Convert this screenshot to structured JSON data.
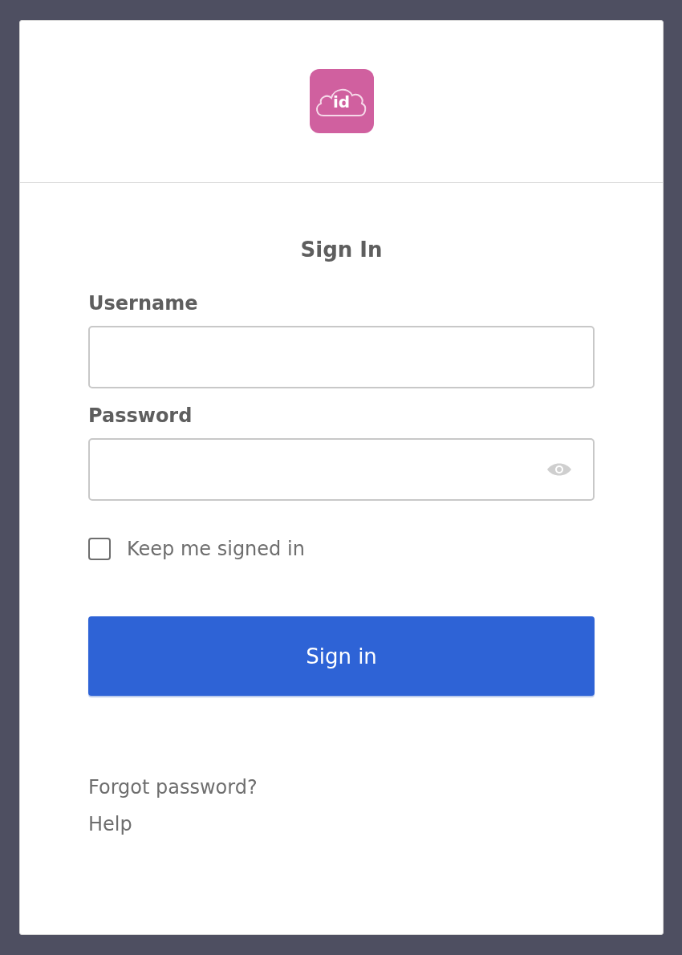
{
  "logo": {
    "text": "id"
  },
  "title": "Sign In",
  "fields": [
    {
      "label": "Username",
      "kind": "text"
    },
    {
      "label": "Password",
      "kind": "password"
    }
  ],
  "remember": {
    "label": "Keep me signed in",
    "checked": false
  },
  "submit": "Sign in",
  "links": [
    "Forgot password?",
    "Help"
  ]
}
